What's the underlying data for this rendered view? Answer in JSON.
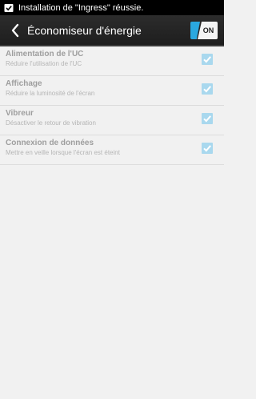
{
  "status_bar": {
    "icon": "checkbox-check-icon",
    "notification": "Installation de \"Ingress\" réussie."
  },
  "action_bar": {
    "title": "Économiseur d'énergie",
    "back_icon": "chevron-left-icon",
    "toggle_label": "ON",
    "toggle_state": "on",
    "accent_color": "#2aa8df"
  },
  "settings": {
    "items": [
      {
        "title": "Alimentation de l'UC",
        "subtitle": "Réduire l'utilisation de l'UC",
        "checked": true
      },
      {
        "title": "Affichage",
        "subtitle": "Réduire la luminosité de l'écran",
        "checked": true
      },
      {
        "title": "Vibreur",
        "subtitle": "Désactiver le retour de vibration",
        "checked": true
      },
      {
        "title": "Connexion de données",
        "subtitle": "Mettre en veille lorsque l'écran est éteint",
        "checked": true
      }
    ]
  }
}
